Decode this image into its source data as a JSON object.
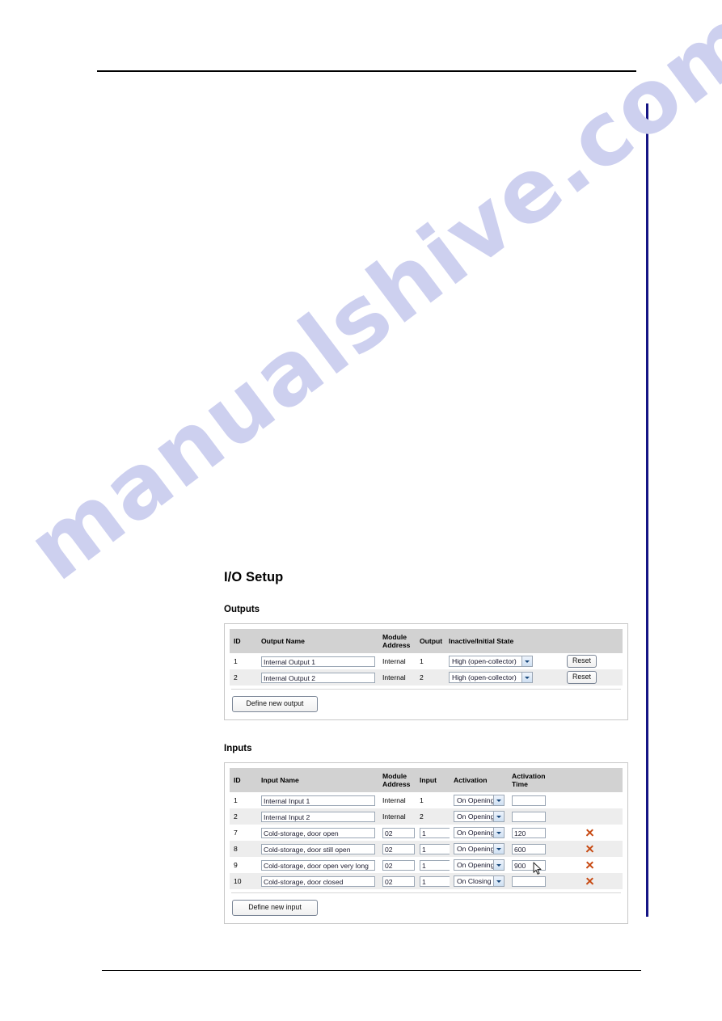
{
  "page": {
    "heading": "I/O Setup",
    "watermark": "manualshive.com"
  },
  "colors": {
    "rule": "#000000",
    "side_bar": "#151585",
    "table_header_bg": "#d2d2d2",
    "row_alt_bg": "#ededed",
    "delete_icon": "#c84b14",
    "watermark": "#cdd0ef"
  },
  "outputs": {
    "section_title": "Outputs",
    "columns": [
      "ID",
      "Output Name",
      "Module Address",
      "Output",
      "Inactive/Initial State",
      ""
    ],
    "rows": [
      {
        "id": "1",
        "name": "Internal Output 1",
        "module_address": "Internal",
        "output": "1",
        "state": "High (open-collector)",
        "reset_label": "Reset"
      },
      {
        "id": "2",
        "name": "Internal Output 2",
        "module_address": "Internal",
        "output": "2",
        "state": "High (open-collector)",
        "reset_label": "Reset"
      }
    ],
    "define_button": "Define new output"
  },
  "inputs": {
    "section_title": "Inputs",
    "columns": [
      "ID",
      "Input Name",
      "Module Address",
      "Input",
      "Activation",
      "Activation Time",
      ""
    ],
    "rows": [
      {
        "id": "1",
        "name": "Internal Input 1",
        "module_address": "Internal",
        "module_address_editable": false,
        "input": "1",
        "input_editable": false,
        "activation": "On Opening",
        "activation_time": "",
        "deletable": false
      },
      {
        "id": "2",
        "name": "Internal Input 2",
        "module_address": "Internal",
        "module_address_editable": false,
        "input": "2",
        "input_editable": false,
        "activation": "On Opening",
        "activation_time": "",
        "deletable": false
      },
      {
        "id": "7",
        "name": "Cold-storage, door open",
        "module_address": "02",
        "module_address_editable": true,
        "input": "1",
        "input_editable": true,
        "activation": "On Opening",
        "activation_time": "120",
        "deletable": true
      },
      {
        "id": "8",
        "name": "Cold-storage, door still open",
        "module_address": "02",
        "module_address_editable": true,
        "input": "1",
        "input_editable": true,
        "activation": "On Opening",
        "activation_time": "600",
        "deletable": true
      },
      {
        "id": "9",
        "name": "Cold-storage, door open very long",
        "module_address": "02",
        "module_address_editable": true,
        "input": "1",
        "input_editable": true,
        "activation": "On Opening",
        "activation_time": "900",
        "deletable": true
      },
      {
        "id": "10",
        "name": "Cold-storage, door closed",
        "module_address": "02",
        "module_address_editable": true,
        "input": "1",
        "input_editable": true,
        "activation": "On Closing",
        "activation_time": "",
        "deletable": true
      }
    ],
    "define_button": "Define new input"
  }
}
